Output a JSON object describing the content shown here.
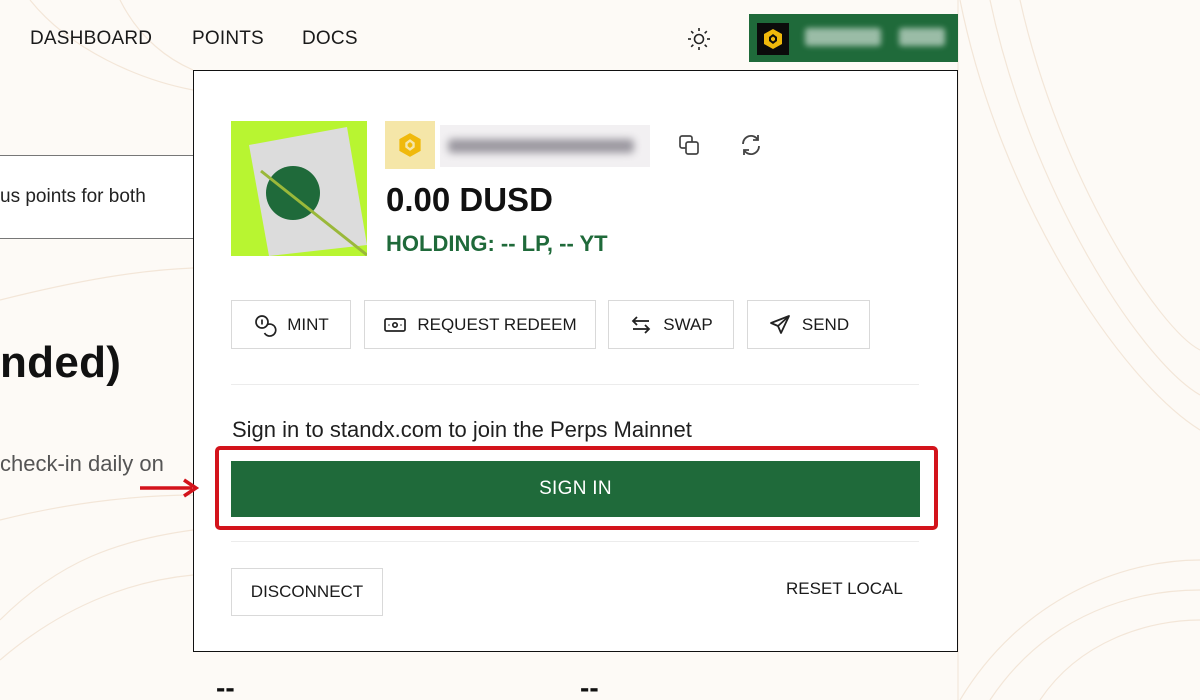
{
  "nav": {
    "items": [
      "DASHBOARD",
      "POINTS",
      "DOCS"
    ]
  },
  "icons": {
    "theme": "sun-icon",
    "chain": "binance-icon",
    "copy": "copy-icon",
    "refresh": "refresh-icon",
    "mint": "coin-icon",
    "redeem": "banknote-icon",
    "swap": "swap-arrows-icon",
    "send": "send-icon"
  },
  "background": {
    "promo_text": "us points for both",
    "heading": "nded)",
    "subtext": "check-in daily on",
    "stat_left": "--",
    "stat_right": "--"
  },
  "panel": {
    "balance": "0.00 DUSD",
    "holding": "HOLDING: -- LP, -- YT",
    "actions": {
      "mint": "MINT",
      "redeem": "REQUEST REDEEM",
      "swap": "SWAP",
      "send": "SEND"
    },
    "signin_message": "Sign in to standx.com to join the Perps Mainnet",
    "signin_label": "SIGN IN",
    "disconnect_label": "DISCONNECT",
    "reset_label": "RESET LOCAL"
  },
  "colors": {
    "brand_green": "#1f6a3a",
    "annotation_red": "#d3131b",
    "avatar_lime": "#b8f531"
  }
}
